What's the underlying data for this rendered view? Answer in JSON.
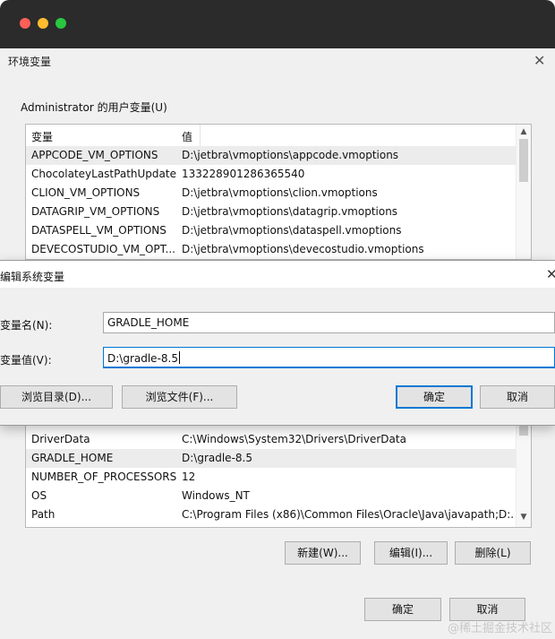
{
  "env_dialog": {
    "title": "环境变量",
    "user_section_label": "Administrator 的用户变量(U)",
    "columns": [
      "变量",
      "值"
    ],
    "user_vars": [
      {
        "name": "APPCODE_VM_OPTIONS",
        "value": "D:\\jetbra\\vmoptions\\appcode.vmoptions"
      },
      {
        "name": "ChocolateyLastPathUpdate",
        "value": "133228901286365540"
      },
      {
        "name": "CLION_VM_OPTIONS",
        "value": "D:\\jetbra\\vmoptions\\clion.vmoptions"
      },
      {
        "name": "DATAGRIP_VM_OPTIONS",
        "value": "D:\\jetbra\\vmoptions\\datagrip.vmoptions"
      },
      {
        "name": "DATASPELL_VM_OPTIONS",
        "value": "D:\\jetbra\\vmoptions\\dataspell.vmoptions"
      },
      {
        "name": "DEVECOSTUDIO_VM_OPT...",
        "value": "D:\\jetbra\\vmoptions\\devecostudio.vmoptions"
      }
    ],
    "system_vars": [
      {
        "name": "DriverData",
        "value": "C:\\Windows\\System32\\Drivers\\DriverData"
      },
      {
        "name": "GRADLE_HOME",
        "value": "D:\\gradle-8.5"
      },
      {
        "name": "NUMBER_OF_PROCESSORS",
        "value": "12"
      },
      {
        "name": "OS",
        "value": "Windows_NT"
      },
      {
        "name": "Path",
        "value": "C:\\Program Files (x86)\\Common Files\\Oracle\\Java\\javapath;D:..."
      }
    ],
    "buttons": {
      "new": "新建(W)...",
      "edit": "编辑(I)...",
      "delete": "删除(L)",
      "ok": "确定",
      "cancel": "取消"
    }
  },
  "edit_dialog": {
    "title": "编辑系统变量",
    "name_label": "变量名(N):",
    "name_value": "GRADLE_HOME",
    "value_label": "变量值(V):",
    "value_value": "D:\\gradle-8.5",
    "buttons": {
      "browse_dir": "浏览目录(D)...",
      "browse_file": "浏览文件(F)...",
      "ok": "确定",
      "cancel": "取消"
    }
  },
  "watermark": "@稀土掘金技术社区",
  "colors": {
    "accent": "#0078d4",
    "title_bar": "#2b2b2b",
    "window_bg": "#f0f0f0"
  }
}
